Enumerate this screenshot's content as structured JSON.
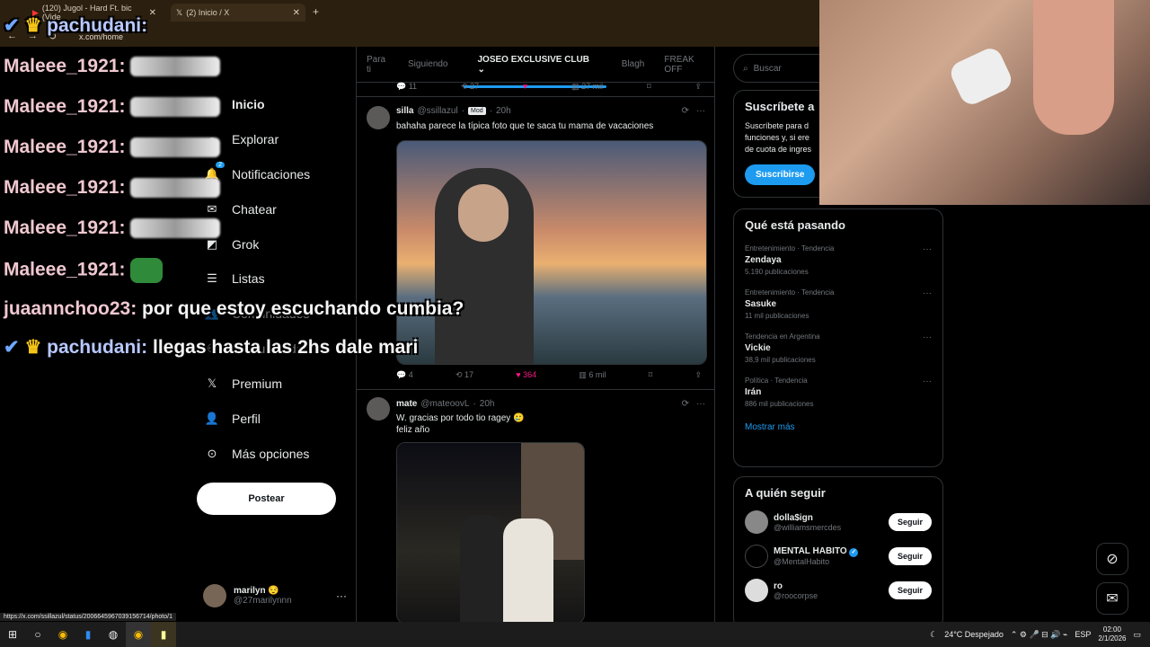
{
  "browser": {
    "tab1_title": "(120) Jugol - Hard Ft. bic (Vide",
    "tab2_title": "(2) Inicio / X",
    "new_tab": "+",
    "url": "x.com/home",
    "status_url": "https://x.com/ssillazul/status/2006645967039156714/photo/1"
  },
  "chat": {
    "lines": [
      {
        "user": "pachudani:",
        "msg": ""
      },
      {
        "user": "Maleee_1921:",
        "msg": ""
      },
      {
        "user": "Maleee_1921:",
        "msg": ""
      },
      {
        "user": "Maleee_1921:",
        "msg": ""
      },
      {
        "user": "Maleee_1921:",
        "msg": ""
      },
      {
        "user": "Maleee_1921:",
        "msg": ""
      },
      {
        "user": "Maleee_1921:",
        "msg": ""
      },
      {
        "user": "juaannchoo23:",
        "msg": "por que estoy escuchando cumbia?"
      },
      {
        "user": "pachudani:",
        "msg": "llegas hasta las 2hs dale mari"
      }
    ]
  },
  "sidebar": {
    "items": [
      {
        "label": "Inicio",
        "icon": "home-icon"
      },
      {
        "label": "Explorar",
        "icon": "search-icon"
      },
      {
        "label": "Notificaciones",
        "icon": "bell-icon",
        "badge": "2"
      },
      {
        "label": "Chatear",
        "icon": "mail-icon"
      },
      {
        "label": "Grok",
        "icon": "grok-icon"
      },
      {
        "label": "Listas",
        "icon": "list-icon"
      },
      {
        "label": "Comunidades",
        "icon": "communities-icon"
      },
      {
        "label": "Comunidades",
        "icon": "people-icon"
      },
      {
        "label": "Premium",
        "icon": "x-logo-icon"
      },
      {
        "label": "Perfil",
        "icon": "profile-icon"
      },
      {
        "label": "Más opciones",
        "icon": "more-options-icon"
      }
    ],
    "post_label": "Postear",
    "account": {
      "name": "marilyn 😌",
      "handle": "@27marilynnn",
      "more": "···"
    }
  },
  "feed": {
    "tabs": [
      "Para ti",
      "Siguiendo",
      "JOSEO EXCLUSIVE CLUB",
      "Blagh",
      "FREAK OFF"
    ],
    "prev_actions": {
      "replies": "11",
      "reposts": "27",
      "likes": "",
      "views": "27 mil"
    },
    "tweets": [
      {
        "name": "silla",
        "handle": "@ssillazul",
        "badge": "Mod",
        "time": "20h",
        "text": "bahaha parece la típica foto que te saca tu mama de vacaciones",
        "replies": "4",
        "reposts": "17",
        "likes": "364",
        "views": "6 mil"
      },
      {
        "name": "mate",
        "handle": "@mateoovL",
        "time": "20h",
        "text1": "W. gracias por todo tio ragey 🥲",
        "text2": "feliz año"
      }
    ]
  },
  "right": {
    "search_placeholder": "Buscar",
    "subscribe": {
      "title": "Suscríbete a",
      "text1": "Suscríbete para d",
      "text2": "funciones y, si ere",
      "text3": "de cuota de ingres",
      "button": "Suscribirse"
    },
    "trends_title": "Qué está pasando",
    "trends": [
      {
        "meta": "Entretenimiento · Tendencia",
        "name": "Zendaya",
        "count": "5.190 publicaciones"
      },
      {
        "meta": "Entretenimiento · Tendencia",
        "name": "Sasuke",
        "count": "11 mil publicaciones"
      },
      {
        "meta": "Tendencia en Argentina",
        "name": "Vickie",
        "count": "38,9 mil publicaciones"
      },
      {
        "meta": "Política · Tendencia",
        "name": "Irán",
        "count": "886 mil publicaciones"
      }
    ],
    "show_more": "Mostrar más",
    "follow_title": "A quién seguir",
    "follows": [
      {
        "name": "dolla$ign",
        "handle": "@williamsmercdes",
        "button": "Seguir"
      },
      {
        "name": "MENTAL HABITO",
        "handle": "@MentalHabito",
        "button": "Seguir",
        "verified": true
      },
      {
        "name": "ro",
        "handle": "@roocorpse",
        "button": "Seguir"
      }
    ]
  },
  "taskbar": {
    "weather": "24°C  Despejado",
    "lang": "ESP",
    "time": "02:00",
    "date": "2/1/2026"
  }
}
